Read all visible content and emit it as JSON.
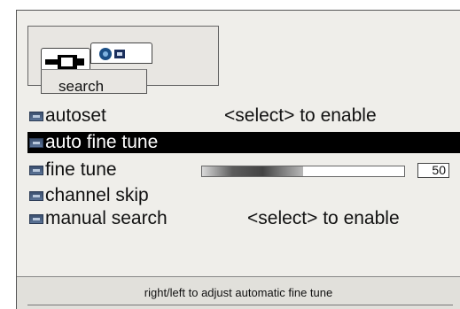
{
  "tabs": {
    "active_label": "search",
    "active_icon": "antenna-plug-icon",
    "secondary_icon": "picture-mode-icon"
  },
  "menu": {
    "items": [
      {
        "label": "autoset",
        "value": "<select> to enable"
      },
      {
        "label": "auto fine tune",
        "value": ""
      },
      {
        "label": "fine tune",
        "value": "50"
      },
      {
        "label": "channel skip",
        "value": ""
      },
      {
        "label": "manual search",
        "value": "<select> to enable"
      }
    ],
    "selected_index": 1,
    "fine_tune_level": 0.5
  },
  "status": {
    "hint": "right/left to adjust automatic fine tune"
  },
  "colors": {
    "selected_bg": "#000000",
    "panel_bg": "#efeeea"
  }
}
